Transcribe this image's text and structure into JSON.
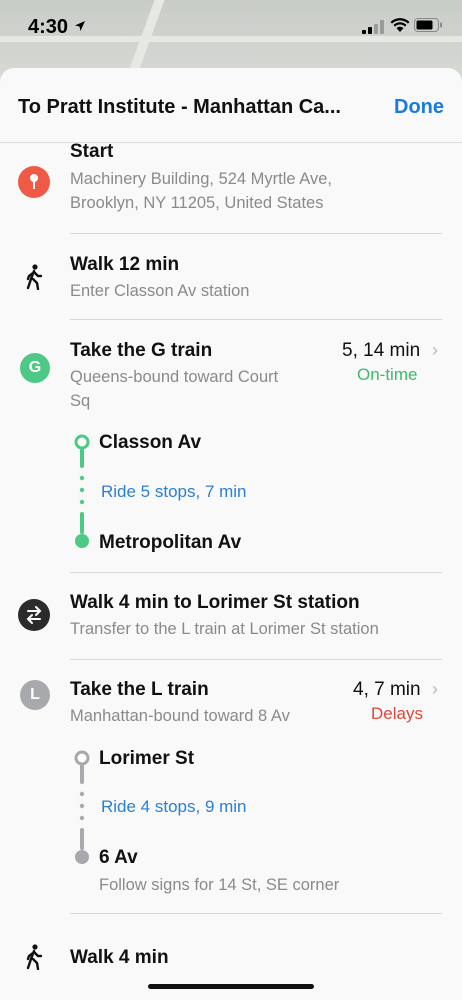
{
  "status": {
    "time": "4:30"
  },
  "header": {
    "title": "To Pratt Institute - Manhattan Ca...",
    "done_label": "Done"
  },
  "steps": {
    "start": {
      "title": "Start",
      "line1": "Machinery Building, 524 Myrtle Ave,",
      "line2": "Brooklyn, NY  11205, United States"
    },
    "walk1": {
      "title": "Walk 12 min",
      "detail": "Enter Classon Av station"
    },
    "g_train": {
      "badge": "G",
      "title": "Take the G train",
      "line1": "Queens-bound toward Court",
      "line2": "Sq",
      "times": "5, 14 min",
      "status": "On-time",
      "from_stop": "Classon Av",
      "ride": "Ride 5 stops, 7 min",
      "to_stop": "Metropolitan Av",
      "color": "#4ec985"
    },
    "transfer": {
      "title": "Walk 4 min to Lorimer St station",
      "detail": "Transfer to the L train at Lorimer St station"
    },
    "l_train": {
      "badge": "L",
      "title": "Take the L train",
      "line1": "Manhattan-bound toward 8 Av",
      "times": "4, 7 min",
      "status": "Delays",
      "from_stop": "Lorimer St",
      "ride": "Ride 4 stops, 9 min",
      "to_stop": "6 Av",
      "to_detail": "Follow signs for 14 St, SE corner",
      "color": "#a7a9ac"
    },
    "walk_final": {
      "title": "Walk 4 min"
    }
  }
}
